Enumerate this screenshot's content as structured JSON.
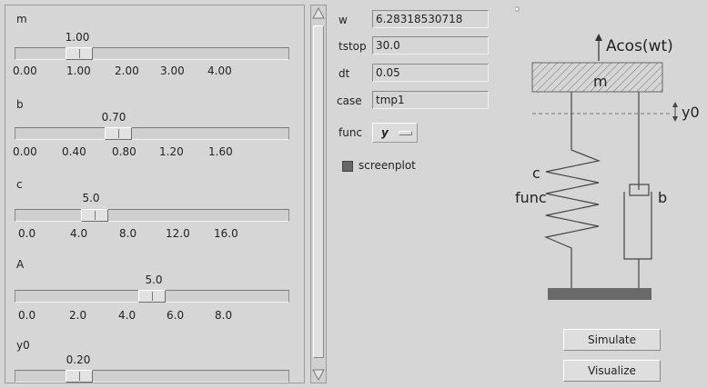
{
  "sliders": [
    {
      "label": "m",
      "value": "1.00",
      "fraction": 0.25,
      "ticks": [
        "0.00",
        "1.00",
        "2.00",
        "3.00",
        "4.00"
      ]
    },
    {
      "label": "b",
      "value": "0.70",
      "fraction": 0.35,
      "ticks": [
        "0.00",
        "0.40",
        "0.80",
        "1.20",
        "1.60"
      ]
    },
    {
      "label": "c",
      "value": "5.0",
      "fraction": 0.25,
      "ticks": [
        "0.0",
        "4.0",
        "8.0",
        "12.0",
        "16.0"
      ]
    },
    {
      "label": "A",
      "value": "5.0",
      "fraction": 0.5,
      "ticks": [
        "0.0",
        "2.0",
        "4.0",
        "6.0",
        "8.0"
      ]
    },
    {
      "label": "y0",
      "value": "0.20",
      "fraction": 0.25,
      "ticks": []
    }
  ],
  "fields": [
    {
      "label": "w",
      "value": "6.28318530718"
    },
    {
      "label": "tstop",
      "value": "30.0"
    },
    {
      "label": "dt",
      "value": "0.05"
    },
    {
      "label": "case",
      "value": "tmp1"
    }
  ],
  "func": {
    "label": "func",
    "value": "y"
  },
  "screenplot": {
    "label": "screenplot",
    "checked": true
  },
  "diagram": {
    "force_label": "Acos(wt)",
    "mass_label": "m",
    "y0_label": "y0",
    "spring_label": "c",
    "func_label": "func",
    "damper_label": "b"
  },
  "buttons": {
    "simulate": "Simulate",
    "visualize": "Visualize"
  }
}
